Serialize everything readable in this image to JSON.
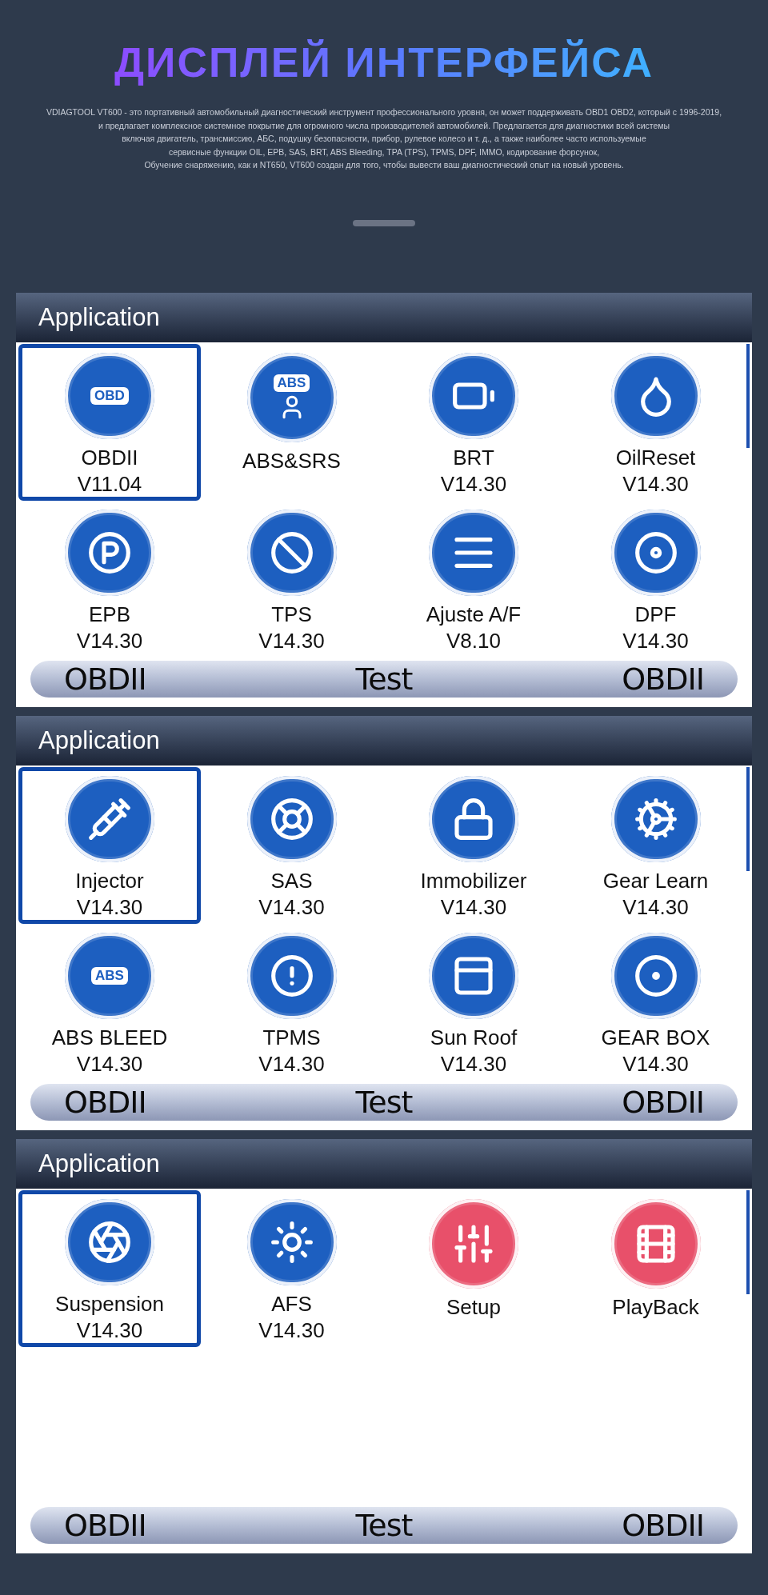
{
  "title": "ДИСПЛЕЙ ИНТЕРФЕЙСА",
  "description_lines": [
    "VDIAGTOOL VT600 - это портативный автомобильный диагностический инструмент профессионального уровня, он может поддерживать OBD1 OBD2, который с 1996-2019,",
    "и предлагает комплексное системное покрытие для огромного числа производителей автомобилей. Предлагается для диагностики всей системы",
    "включая двигатель, трансмиссию, АБС, подушку безопасности, прибор, рулевое колесо и т. д., а также наиболее часто используемые",
    "сервисные функции OIL, EPB, SAS, BRT, ABS Bleeding, TPA (TPS), TPMS, DPF, IMMO, кодирование форсунок,",
    "Обучение снаряжению, как и NT650, VT600 создан для того, чтобы вывести ваш диагностический опыт на новый уровень."
  ],
  "panels": [
    {
      "header": "Application",
      "items": [
        {
          "name": "OBDII",
          "version": "V11.04",
          "selected": true,
          "color": "#1d5fc0",
          "icon_label": "OBD"
        },
        {
          "name": "ABS&SRS",
          "selected": false,
          "color": "#1d5fc0",
          "icon_label": "ABS"
        },
        {
          "name": "BRT",
          "version": "V14.30",
          "selected": false,
          "color": "#1d5fc0"
        },
        {
          "name": "OilReset",
          "version": "V14.30",
          "selected": false,
          "color": "#1d5fc0"
        },
        {
          "name": "EPB",
          "version": "V14.30",
          "selected": false,
          "color": "#1d5fc0"
        },
        {
          "name": "TPS",
          "version": "V14.30",
          "selected": false,
          "color": "#1d5fc0"
        },
        {
          "name": "Ajuste A/F",
          "version": "V8.10",
          "selected": false,
          "color": "#1d5fc0"
        },
        {
          "name": "DPF",
          "version": "V14.30",
          "selected": false,
          "color": "#1d5fc0"
        }
      ],
      "bar": [
        "OBDII",
        "Test",
        "OBDII"
      ]
    },
    {
      "header": "Application",
      "items": [
        {
          "name": "Injector",
          "version": "V14.30",
          "selected": true,
          "color": "#1d5fc0"
        },
        {
          "name": "SAS",
          "version": "V14.30",
          "selected": false,
          "color": "#1d5fc0"
        },
        {
          "name": "Immobilizer",
          "version": "V14.30",
          "selected": false,
          "color": "#1d5fc0"
        },
        {
          "name": "Gear Learn",
          "version": "V14.30",
          "selected": false,
          "color": "#1d5fc0"
        },
        {
          "name": "ABS BLEED",
          "version": "V14.30",
          "selected": false,
          "color": "#1d5fc0",
          "icon_label": "ABS"
        },
        {
          "name": "TPMS",
          "version": "V14.30",
          "selected": false,
          "color": "#1d5fc0"
        },
        {
          "name": "Sun Roof",
          "version": "V14.30",
          "selected": false,
          "color": "#1d5fc0"
        },
        {
          "name": "GEAR BOX",
          "version": "V14.30",
          "selected": false,
          "color": "#1d5fc0"
        }
      ],
      "bar": [
        "OBDII",
        "Test",
        "OBDII"
      ]
    },
    {
      "header": "Application",
      "items": [
        {
          "name": "Suspension",
          "version": "V14.30",
          "selected": true,
          "color": "#1d5fc0"
        },
        {
          "name": "AFS",
          "version": "V14.30",
          "selected": false,
          "color": "#1d5fc0"
        },
        {
          "name": "Setup",
          "selected": false,
          "color": "#e8506a"
        },
        {
          "name": "PlayBack",
          "selected": false,
          "color": "#e8506a"
        }
      ],
      "bar": [
        "OBDII",
        "Test",
        "OBDII"
      ]
    }
  ]
}
